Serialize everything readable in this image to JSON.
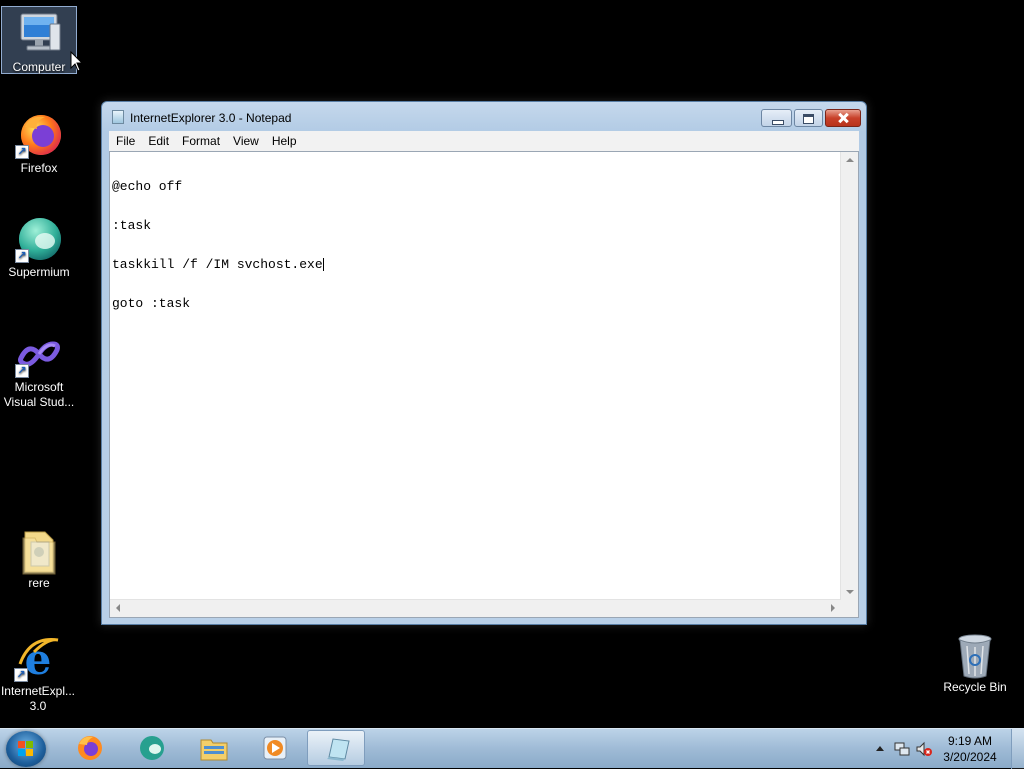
{
  "desktop": {
    "icons": [
      {
        "label": "Computer",
        "icon": "computer-icon"
      },
      {
        "label": "Firefox",
        "icon": "firefox-icon"
      },
      {
        "label": "Supermium",
        "icon": "supermium-icon"
      },
      {
        "label_line1": "Microsoft",
        "label_line2": "Visual Stud...",
        "icon": "visual-studio-icon"
      },
      {
        "label": "rere",
        "icon": "folder-icon"
      },
      {
        "label_line1": "InternetExpl...",
        "label_line2": "3.0",
        "icon": "internet-explorer-icon"
      },
      {
        "label": "Recycle Bin",
        "icon": "recycle-bin-icon"
      }
    ]
  },
  "notepad": {
    "title": "InternetExplorer 3.0 - Notepad",
    "menu": [
      "File",
      "Edit",
      "Format",
      "View",
      "Help"
    ],
    "lines": [
      "@echo off",
      ":task",
      "taskkill /f /IM svchost.exe",
      "goto :task"
    ]
  },
  "taskbar": {
    "apps": [
      "firefox-icon",
      "supermium-icon",
      "explorer-icon",
      "media-player-icon",
      "notepad-icon"
    ],
    "active_app": "notepad-icon",
    "clock": {
      "time": "9:19 AM",
      "date": "3/20/2024"
    },
    "tray_icons": [
      "show-hidden-icons-arrow",
      "network-icon",
      "volume-muted-icon"
    ]
  },
  "colors": {
    "window_frame": "#b9d0e8",
    "close_button": "#c8412a",
    "taskbar": "#9fbbd6",
    "desktop": "#000000"
  }
}
